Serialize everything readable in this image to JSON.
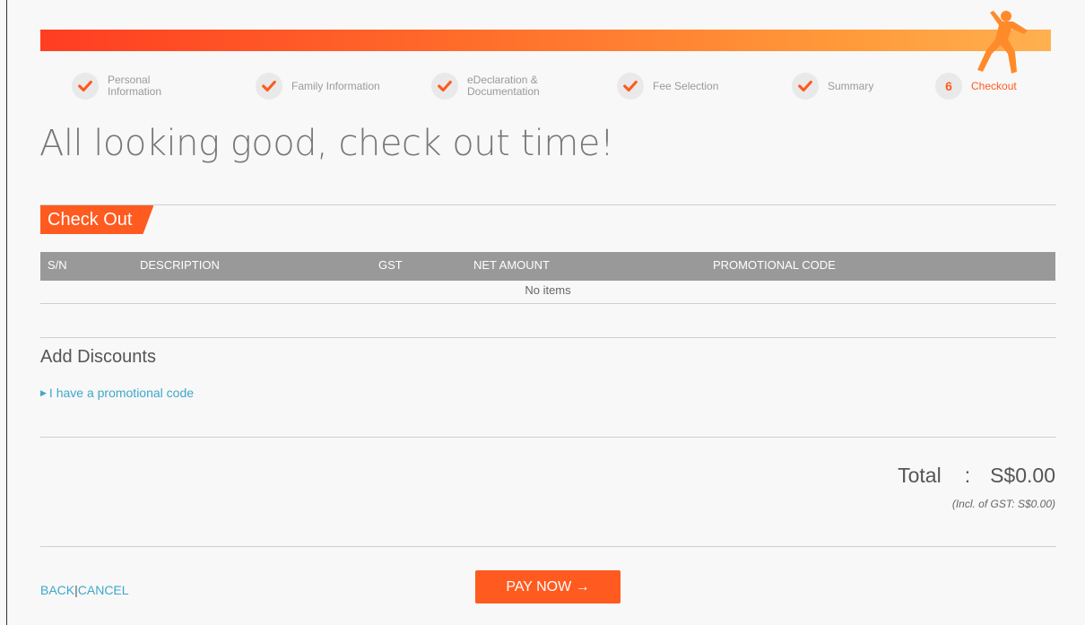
{
  "steps": [
    {
      "label": "Personal Information",
      "state": "done"
    },
    {
      "label": "Family Information",
      "state": "done"
    },
    {
      "label": "eDeclaration & Documentation",
      "state": "done"
    },
    {
      "label": "Fee Selection",
      "state": "done"
    },
    {
      "label": "Summary",
      "state": "done"
    },
    {
      "label": "Checkout",
      "state": "active",
      "number": "6"
    }
  ],
  "page_title": "All looking good, check out time!",
  "checkout": {
    "section_title": "Check Out",
    "columns": [
      "S/N",
      "DESCRIPTION",
      "GST",
      "NET AMOUNT",
      "PROMOTIONAL CODE"
    ],
    "empty_text": "No items"
  },
  "discounts": {
    "title": "Add Discounts",
    "promo_link": "I have a promotional code"
  },
  "totals": {
    "label": "Total",
    "colon": ":",
    "amount": "S$0.00",
    "gst_note": "(Incl. of GST: S$0.00)"
  },
  "footer": {
    "back_label": "BACK",
    "separator": "|",
    "cancel_label": "CANCEL",
    "pay_label": "PAY NOW →"
  },
  "colors": {
    "accent": "#ff5a1f",
    "link": "#3fa7c9",
    "table_header": "#999999"
  }
}
